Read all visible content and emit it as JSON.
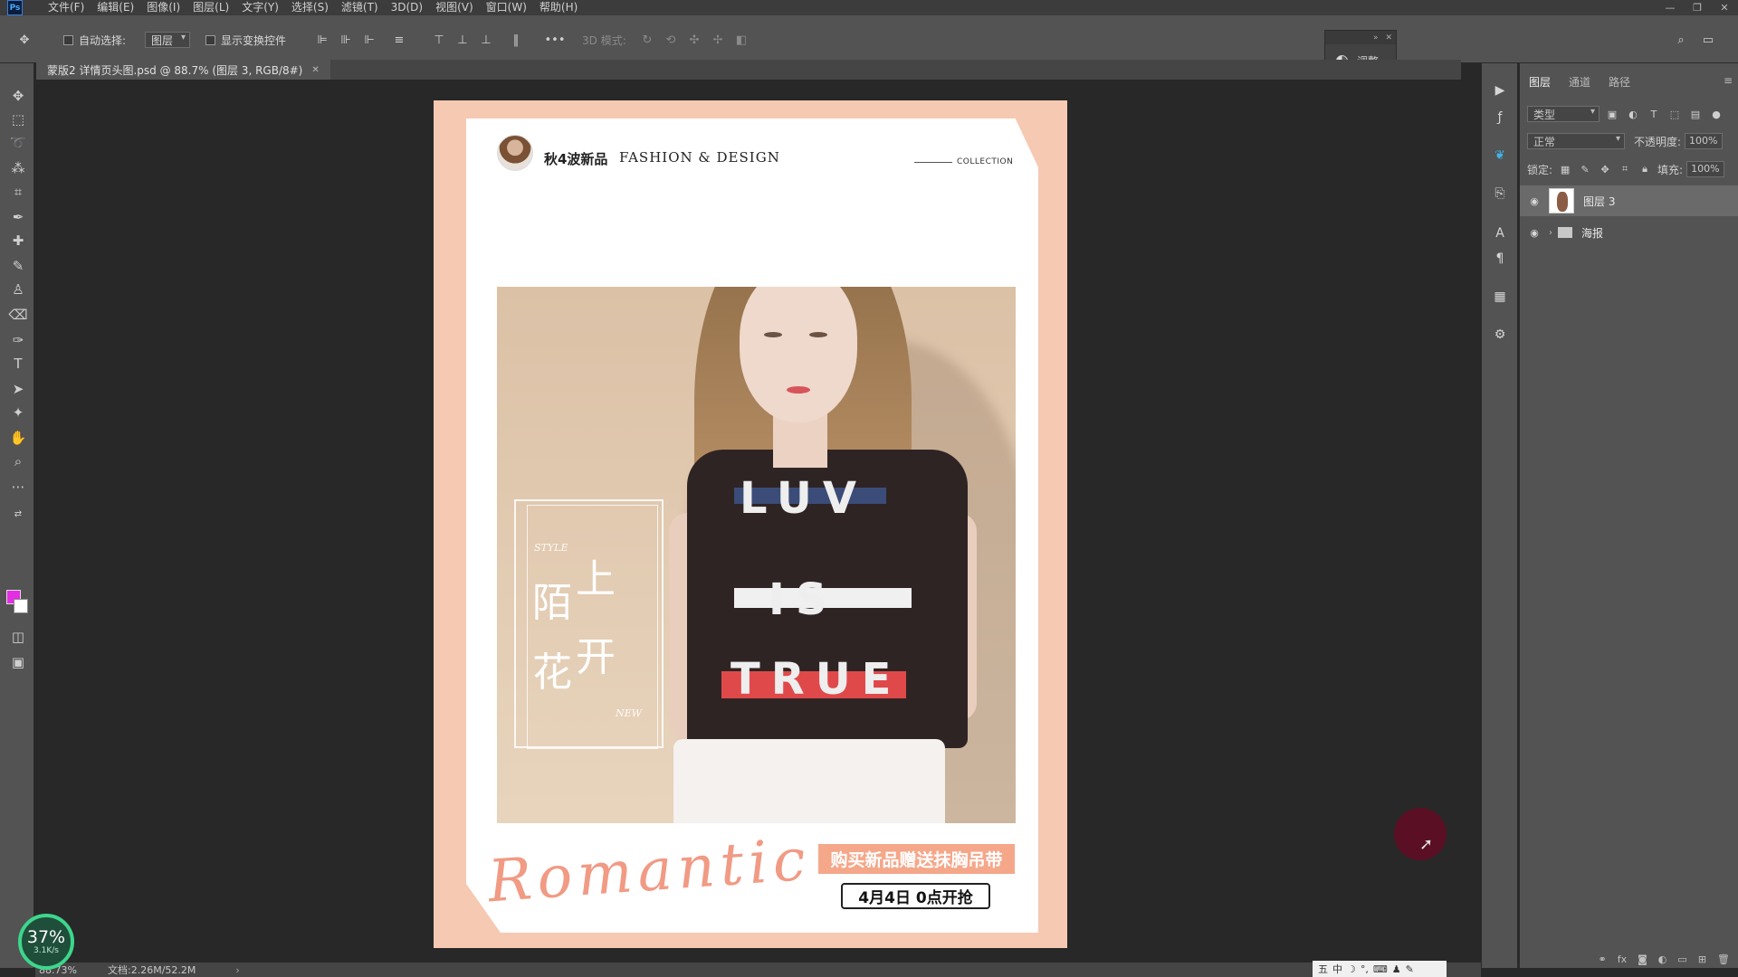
{
  "menubar": {
    "logo": "Ps",
    "items": [
      "文件(F)",
      "编辑(E)",
      "图像(I)",
      "图层(L)",
      "文字(Y)",
      "选择(S)",
      "滤镜(T)",
      "3D(D)",
      "视图(V)",
      "窗口(W)",
      "帮助(H)"
    ],
    "window_controls": [
      "—",
      "❐",
      "✕"
    ]
  },
  "options": {
    "auto_select_label": "自动选择:",
    "auto_select_value": "图层",
    "show_transform_label": "显示变换控件",
    "mode_3d_label": "3D 模式:",
    "more": "•••"
  },
  "adjust_panel": {
    "label": "调整"
  },
  "document_tab": {
    "title": "蒙版2 详情页头图.psd @ 88.7% (图层 3, RGB/8#)",
    "close": "✕"
  },
  "poster": {
    "brand_cn": "秋4波新品",
    "brand_en": "FASHION & DESIGN",
    "collection": "COLLECTION",
    "shirt_line1": "LUV",
    "shirt_line2": "IS",
    "shirt_line3": "TRUE",
    "style_word": "STYLE",
    "cn_top_right": "上",
    "cn_left_top": "陌",
    "cn_left_bottom": "花",
    "cn_bottom_right": "开",
    "new_word": "NEW",
    "romantic": "Romantic",
    "promo": "购买新品赠送抹胸吊带",
    "date": "4月4日 0点开抢"
  },
  "layers_panel": {
    "tabs": [
      "图层",
      "通道",
      "路径"
    ],
    "filter_label": "类型",
    "blend_mode": "正常",
    "opacity_label": "不透明度:",
    "opacity_value": "100%",
    "lock_label": "锁定:",
    "fill_label": "填充:",
    "fill_value": "100%",
    "layers": [
      {
        "name": "图层 3",
        "selected": true,
        "type": "image"
      },
      {
        "name": "海报",
        "selected": false,
        "type": "group"
      }
    ]
  },
  "status": {
    "zoom": "88.73%",
    "doc_size": "文档:2.26M/52.2M",
    "arrow": "›"
  },
  "perf_badge": {
    "percent": "37%",
    "speed": "3.1K/s"
  },
  "ime_bar": {
    "items": [
      "五",
      "中",
      "☽",
      "°,",
      "⌨",
      "♟",
      "✎"
    ]
  },
  "colors": {
    "foreground": "#e42de4",
    "background": "#ffffff",
    "poster_bg": "#f6c9b2",
    "promo": "#f5a78a"
  }
}
